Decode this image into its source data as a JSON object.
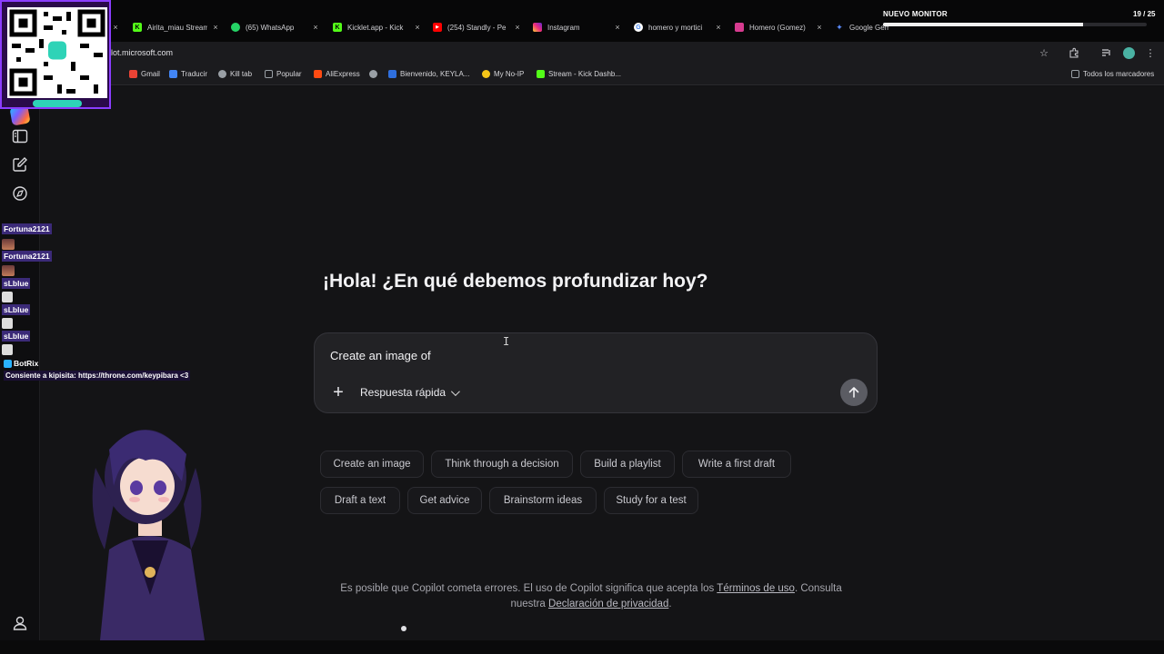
{
  "browser": {
    "tabs": [
      {
        "label": "Airita_miau Stream",
        "favicon_color": "#53fc18",
        "favicon_letter": "K"
      },
      {
        "label": "(65) WhatsApp",
        "favicon_color": "#25d366",
        "favicon_letter": ""
      },
      {
        "label": "Kicklet.app - Kick",
        "favicon_color": "#53fc18",
        "favicon_letter": "K"
      },
      {
        "label": "(254) Standly - Pe",
        "favicon_color": "#ff0000",
        "favicon_letter": "▶"
      },
      {
        "label": "Instagram",
        "favicon_color": "#e1306c",
        "favicon_letter": ""
      },
      {
        "label": "homero y mortici",
        "favicon_color": "#4285f4",
        "favicon_letter": "G"
      },
      {
        "label": "Homero (Gomez)",
        "favicon_color": "#d63b8f",
        "favicon_letter": ""
      },
      {
        "label": "Google Gemini",
        "favicon_color": "#5b8cff",
        "favicon_letter": "✦"
      }
    ],
    "url": "lot.microsoft.com",
    "bookmarks": [
      {
        "label": "Gmail",
        "color": "#ea4335"
      },
      {
        "label": "Traducir",
        "color": "#4285f4"
      },
      {
        "label": "Kill tab",
        "color": "#9aa0a6"
      },
      {
        "label": "Popular",
        "color": "#9aa0a6"
      },
      {
        "label": "AliExpress",
        "color": "#ff4b12"
      },
      {
        "label": "",
        "color": "#9aa0a6"
      },
      {
        "label": "Bienvenido, KEYLA...",
        "color": "#2f6fde"
      },
      {
        "label": "My No-IP",
        "color": "#f5c518"
      },
      {
        "label": "Stream - Kick Dashb...",
        "color": "#53fc18"
      }
    ],
    "all_bookmarks_label": "Todos los marcadores"
  },
  "stream_overlay": {
    "title": "NUEVO MONITOR",
    "count": "19 / 25",
    "progress": 0.76,
    "qr_caption": "",
    "chat": [
      {
        "name": "Fortuna2121"
      },
      {
        "name": "Fortuna2121"
      },
      {
        "name": "sLblue"
      },
      {
        "name": "sLblue"
      },
      {
        "name": "sLblue"
      }
    ],
    "bot_name": "BotRix",
    "bot_message": "Consiente a kipisita: https://throne.com/keypibara <3"
  },
  "copilot": {
    "greeting": "¡Hola! ¿En qué debemos profundizar hoy?",
    "composer_text": "Create an image of",
    "mode_label": "Respuesta rápida",
    "suggestions_row1": [
      "Create an image",
      "Think through a decision",
      "Build a playlist",
      "Write a first draft"
    ],
    "suggestions_row2": [
      "Draft a text",
      "Get advice",
      "Brainstorm ideas",
      "Study for a test"
    ],
    "disclaimer_pre": "Es posible que Copilot cometa errores. El uso de Copilot significa que acepta los ",
    "terms_link": "Términos de uso",
    "disclaimer_mid": ". Consulta nuestra ",
    "privacy_link": "Declaración de privacidad",
    "disclaimer_post": "."
  }
}
